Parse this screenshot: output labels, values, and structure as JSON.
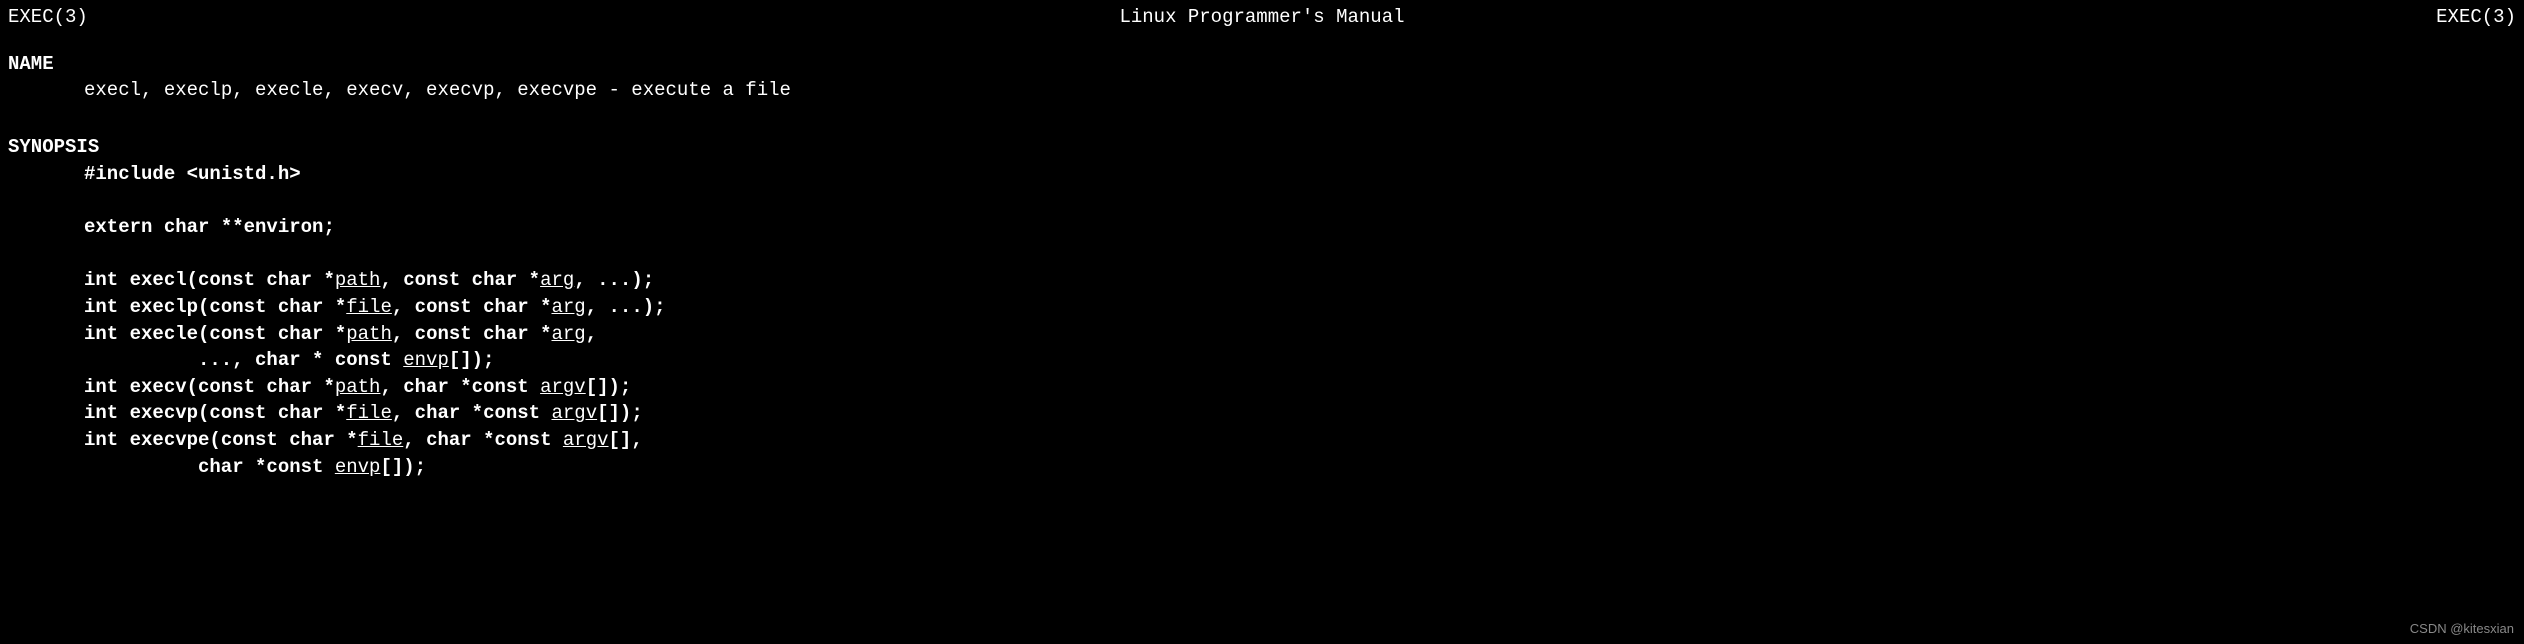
{
  "header": {
    "left": "EXEC(3)",
    "center": "Linux Programmer's Manual",
    "right": "EXEC(3)"
  },
  "sections": {
    "name": {
      "heading": "NAME",
      "text": "execl, execlp, execle, execv, execvp, execvpe - execute a file"
    },
    "synopsis": {
      "heading": "SYNOPSIS",
      "include": "#include <unistd.h>",
      "extern": "extern char **environ;",
      "funcs": {
        "execl": {
          "pre": "int execl(const char *",
          "arg1": "path",
          "mid": ", const char *",
          "arg2": "arg",
          "post": ", ...);"
        },
        "execlp": {
          "pre": "int execlp(const char *",
          "arg1": "file",
          "mid": ", const char *",
          "arg2": "arg",
          "post": ", ...);"
        },
        "execle": {
          "pre": "int execle(const char *",
          "arg1": "path",
          "mid": ", const char *",
          "arg2": "arg",
          "post": ",",
          "cont_pre": "..., char * const ",
          "cont_arg": "envp",
          "cont_post": "[]);"
        },
        "execv": {
          "pre": "int execv(const char *",
          "arg1": "path",
          "mid": ", char *const ",
          "arg2": "argv",
          "post": "[]);"
        },
        "execvp": {
          "pre": "int execvp(const char *",
          "arg1": "file",
          "mid": ", char *const ",
          "arg2": "argv",
          "post": "[]);"
        },
        "execvpe": {
          "pre": "int execvpe(const char *",
          "arg1": "file",
          "mid": ", char *const ",
          "arg2": "argv",
          "post": "[],",
          "cont_pre": "char *const ",
          "cont_arg": "envp",
          "cont_post": "[]);"
        }
      }
    }
  },
  "watermark": "CSDN @kitesxian"
}
